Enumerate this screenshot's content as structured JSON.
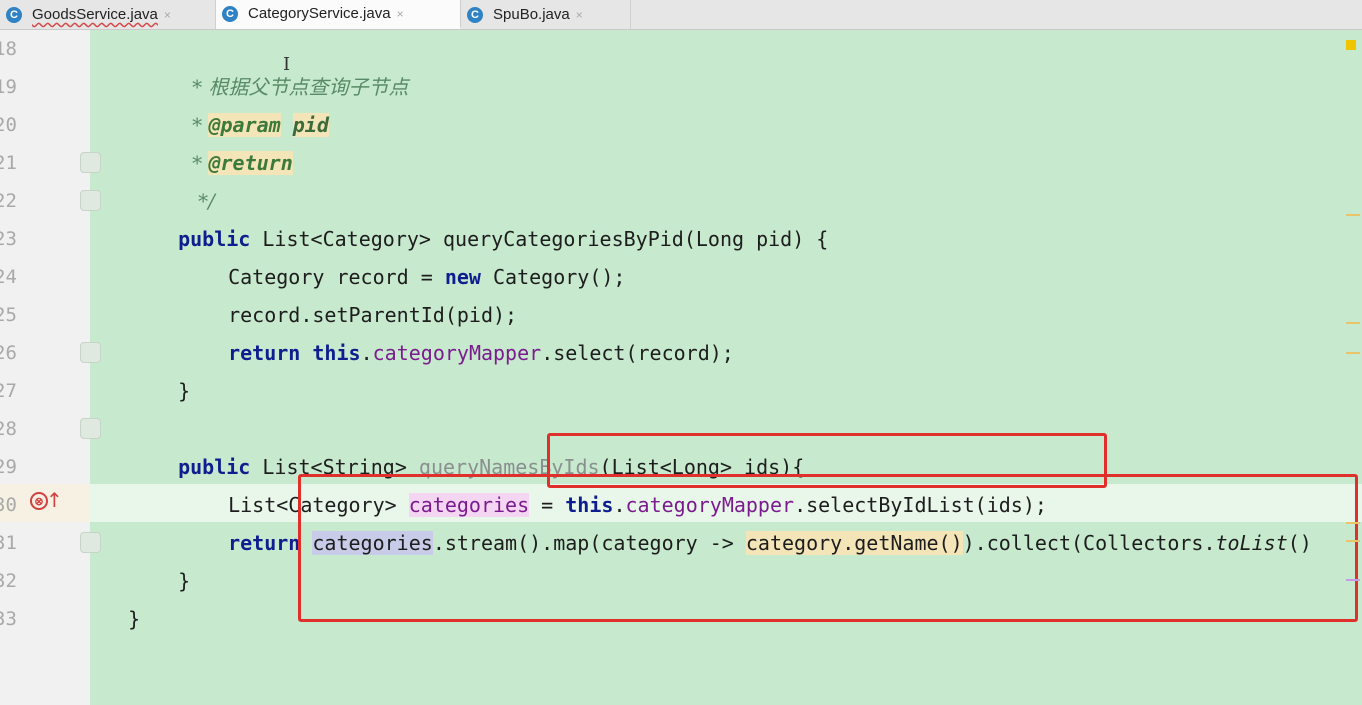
{
  "tabs": [
    {
      "label": "GoodsService.java",
      "icon": "class-icon",
      "letter": "C",
      "active": false
    },
    {
      "label": "CategoryService.java",
      "icon": "class-icon",
      "letter": "C",
      "active": true
    },
    {
      "label": "SpuBo.java",
      "icon": "class-icon",
      "letter": "C",
      "active": false
    }
  ],
  "tab_close": "×",
  "lines": [
    {
      "num": "18"
    },
    {
      "num": "19"
    },
    {
      "num": "20"
    },
    {
      "num": "21"
    },
    {
      "num": "22"
    },
    {
      "num": "23"
    },
    {
      "num": "24"
    },
    {
      "num": "25"
    },
    {
      "num": "26"
    },
    {
      "num": "27"
    },
    {
      "num": "28"
    },
    {
      "num": "29"
    },
    {
      "num": "30"
    },
    {
      "num": "31"
    },
    {
      "num": "32"
    },
    {
      "num": "33"
    }
  ],
  "code": {
    "l18": {
      "star": "* ",
      "text": "根据父节点查询子节点"
    },
    "l19": {
      "star": "* ",
      "tag": "@param",
      "param": "pid"
    },
    "l20": {
      "star": "* ",
      "tag": "@return"
    },
    "l21": {
      "text": "*/"
    },
    "l22": {
      "kw": "public",
      "rest": " List<Category> queryCategoriesByPid(Long pid) {"
    },
    "l23": {
      "a": "Category record = ",
      "kw": "new",
      "b": " Category();"
    },
    "l24": {
      "text": "record.setParentId(pid);"
    },
    "l25": {
      "kw1": "return",
      "kw2": "this",
      "dot": ".",
      "field": "categoryMapper",
      "rest": ".select(record);"
    },
    "l26": {
      "text": "}"
    },
    "l28": {
      "kw": "public",
      "a": " List<String> ",
      "unused": "queryNamesByIds",
      "b": "(List<Long> ids){"
    },
    "l29": {
      "a": "List<Category> ",
      "var": "categories",
      "b": " = ",
      "kw": "this",
      "dot": ".",
      "field": "categoryMapper",
      "rest": ".selectByIdList(ids);"
    },
    "l30": {
      "kw": "return",
      "var": "categories",
      "a": ".stream().map(category -> ",
      "hl": "category.getName()",
      "b": ").collect(Collectors.",
      "it": "toList",
      "c": "()"
    },
    "l31": {
      "text": "}"
    },
    "l32": {
      "text": "}"
    }
  },
  "error_badge": "⊗",
  "error_arrow": "↑",
  "colors": {
    "accent_red": "#e0302b",
    "editor_bg": "#c7e9ce",
    "keyword": "#0f1e8e",
    "field": "#7a1c8e"
  }
}
